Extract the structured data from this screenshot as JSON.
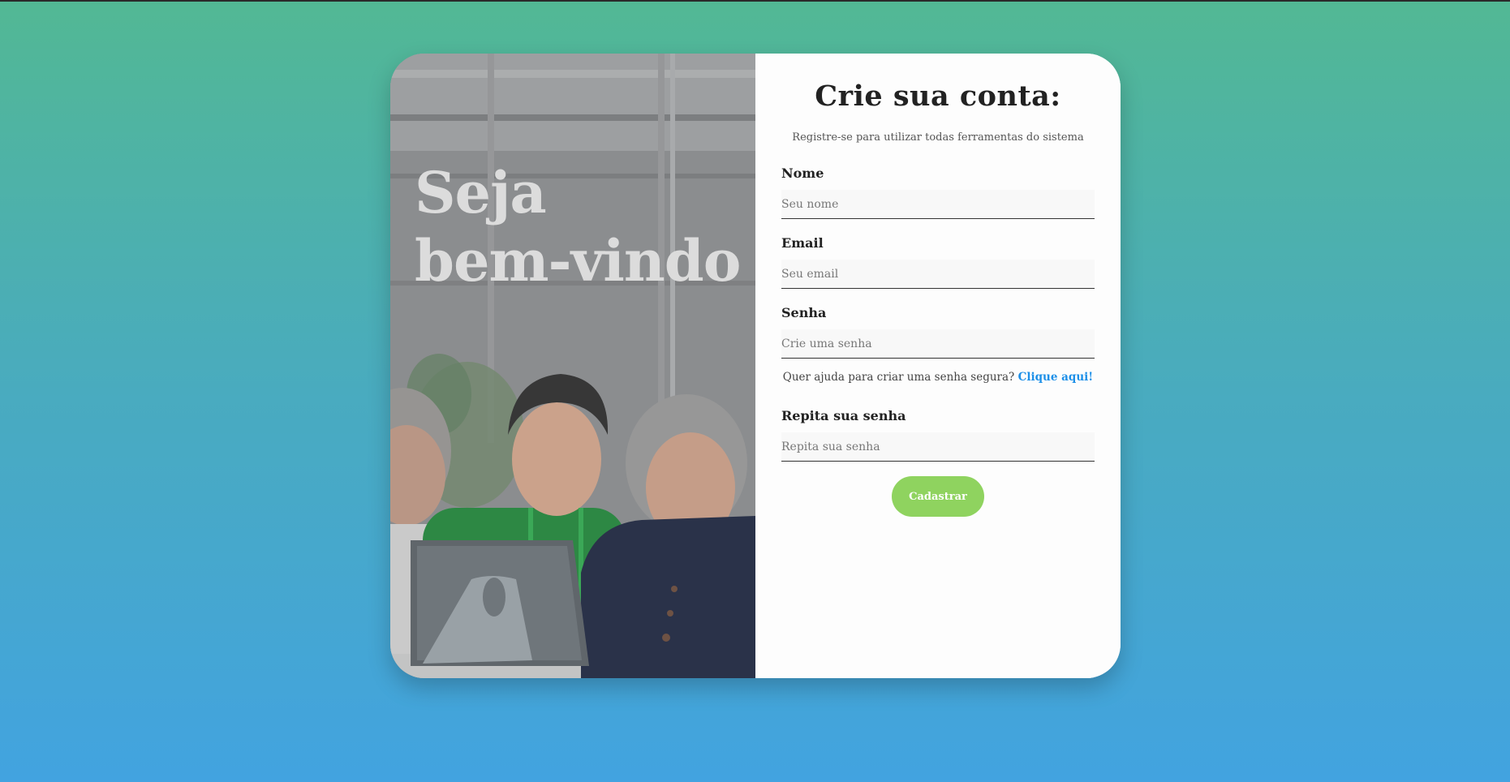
{
  "hero": {
    "line1": "Seja",
    "line2": "bem-vindo"
  },
  "form": {
    "title": "Crie sua conta:",
    "subtitle": "Registre-se para utilizar todas ferramentas do sistema",
    "fields": [
      {
        "label": "Nome",
        "placeholder": "Seu nome"
      },
      {
        "label": "Email",
        "placeholder": "Seu email"
      },
      {
        "label": "Senha",
        "placeholder": "Crie uma senha"
      },
      {
        "label": "Repita sua senha",
        "placeholder": "Repita sua senha"
      }
    ],
    "help_text": "Quer ajuda para criar uma senha segura?",
    "help_link": "Clique aqui!",
    "submit_label": "Cadastrar"
  },
  "colors": {
    "bg_top": "#52b894",
    "bg_bottom": "#42a3e0",
    "link": "#1e90e8",
    "button": "#8fd35f"
  }
}
